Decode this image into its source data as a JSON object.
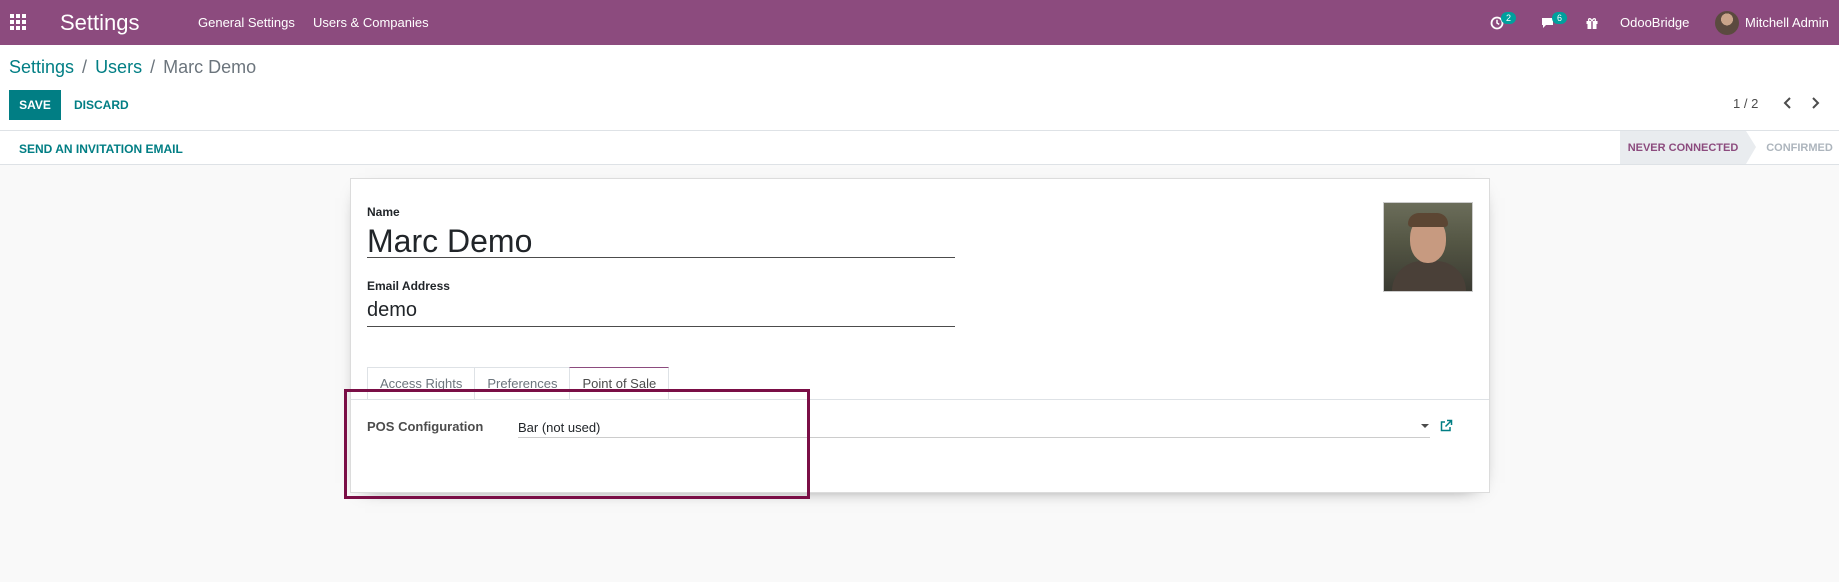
{
  "navbar": {
    "app_title": "Settings",
    "menus": [
      "General Settings",
      "Users & Companies"
    ],
    "activity_count": "2",
    "messages_count": "6",
    "company": "OdooBridge",
    "user": "Mitchell Admin"
  },
  "breadcrumb": {
    "items": [
      "Settings",
      "Users"
    ],
    "separator": "/",
    "current": "Marc Demo"
  },
  "actions": {
    "save": "SAVE",
    "discard": "DISCARD"
  },
  "pager": {
    "value": "1 / 2"
  },
  "statusbar": {
    "invite": "SEND AN INVITATION EMAIL",
    "stages": [
      "NEVER CONNECTED",
      "CONFIRMED"
    ],
    "active_stage": "NEVER CONNECTED"
  },
  "form": {
    "name_label": "Name",
    "name_value": "Marc Demo",
    "email_label": "Email Address",
    "email_value": "demo",
    "tabs": [
      "Access Rights",
      "Preferences",
      "Point of Sale"
    ],
    "active_tab": "Point of Sale",
    "pos_label": "POS Configuration",
    "pos_value": "Bar (not used)"
  },
  "colors": {
    "navbar": "#8c4b7e",
    "primary": "#017e84",
    "badge": "#00a09d",
    "highlight": "#7a0e46"
  }
}
